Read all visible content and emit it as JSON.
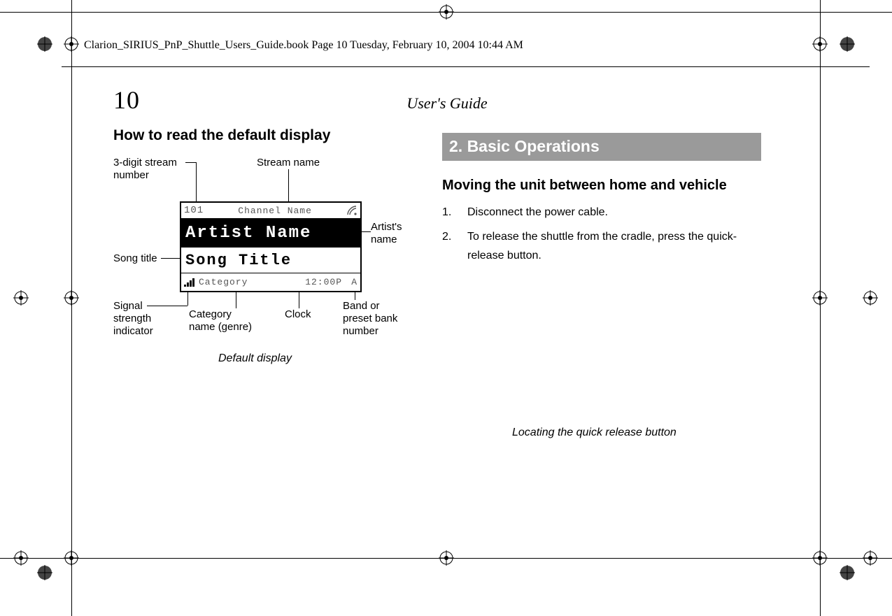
{
  "meta": {
    "book_header": "Clarion_SIRIUS_PnP_Shuttle_Users_Guide.book  Page 10  Tuesday, February 10, 2004  10:44 AM",
    "page_number": "10",
    "guide_title": "User's Guide"
  },
  "left": {
    "heading": "How to read the default display",
    "callouts": {
      "stream_number": "3-digit stream number",
      "stream_name": "Stream name",
      "artist_name": "Artist's name",
      "song_title": "Song title",
      "signal": "Signal strength indicator",
      "category": "Category name (genre)",
      "clock": "Clock",
      "band": "Band or preset bank number"
    },
    "caption": "Default display",
    "lcd": {
      "channel_number": "101",
      "channel_name": "Channel Name",
      "artist": "Artist Name",
      "song": "Song Title",
      "category": "Category",
      "clock": "12:00P",
      "band": "A"
    }
  },
  "right": {
    "section_bar": "2. Basic Operations",
    "subheading": "Moving the unit between home and vehicle",
    "steps": [
      "Disconnect the power cable.",
      "To release the shuttle from the cradle, press the quick-release button."
    ],
    "caption": "Locating the quick release button"
  }
}
